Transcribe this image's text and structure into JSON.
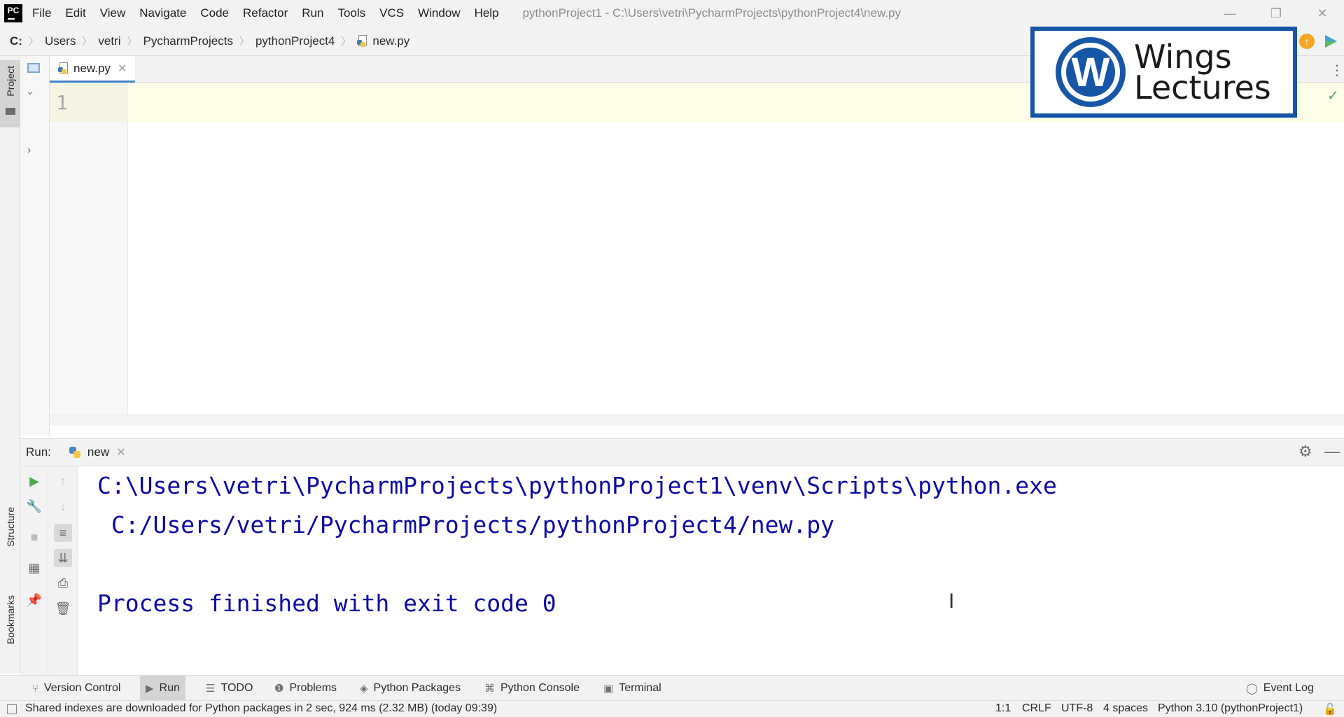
{
  "app": {
    "logo_text": "PC"
  },
  "menu": [
    "File",
    "Edit",
    "View",
    "Navigate",
    "Code",
    "Refactor",
    "Run",
    "Tools",
    "VCS",
    "Window",
    "Help"
  ],
  "window": {
    "title": "pythonProject1 - C:\\Users\\vetri\\PycharmProjects\\pythonProject4\\new.py",
    "controls": {
      "minimize": "—",
      "restore": "❐",
      "close": "✕"
    }
  },
  "breadcrumb": [
    "C:",
    "Users",
    "vetri",
    "PycharmProjects",
    "pythonProject4",
    "new.py"
  ],
  "side_tabs": {
    "project": "Project",
    "structure": "Structure",
    "bookmarks": "Bookmarks"
  },
  "editor": {
    "tab_label": "new.py",
    "line_numbers": [
      "1"
    ],
    "content": ""
  },
  "overlay_logo": {
    "line1": "Wings",
    "line2": "Lectures",
    "mark": "W"
  },
  "run": {
    "title": "Run:",
    "tab_label": "new",
    "console_lines": [
      "C:\\Users\\vetri\\PycharmProjects\\pythonProject1\\venv\\Scripts\\python.exe",
      " C:/Users/vetri/PycharmProjects/pythonProject4/new.py",
      "",
      "Process finished with exit code 0"
    ]
  },
  "bottom_tabs": [
    {
      "label": "Version Control",
      "icon": "branch-icon"
    },
    {
      "label": "Run",
      "icon": "play-icon",
      "active": true
    },
    {
      "label": "TODO",
      "icon": "list-icon"
    },
    {
      "label": "Problems",
      "icon": "info-icon"
    },
    {
      "label": "Python Packages",
      "icon": "layers-icon"
    },
    {
      "label": "Python Console",
      "icon": "python-icon"
    },
    {
      "label": "Terminal",
      "icon": "terminal-icon"
    }
  ],
  "event_log": "Event Log",
  "status": {
    "message": "Shared indexes are downloaded for Python packages in 2 sec, 924 ms (2.32 MB) (today 09:39)",
    "position": "1:1",
    "line_sep": "CRLF",
    "encoding": "UTF-8",
    "indent": "4 spaces",
    "interpreter": "Python 3.10 (pythonProject1)"
  },
  "colors": {
    "console_text": "#0a0aa5",
    "accent": "#4083c9",
    "logo_blue": "#1656a6"
  }
}
